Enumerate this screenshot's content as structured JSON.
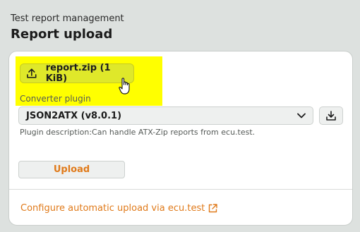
{
  "header": {
    "section": "Test report management",
    "title": "Report upload"
  },
  "file_select": {
    "label": "report.zip (1 KiB)",
    "icon": "upload-icon",
    "highlight_color": "#ffff00"
  },
  "converter": {
    "label": "Converter plugin",
    "selected": "JSON2ATX (v8.0.1)",
    "description": "Plugin description:Can handle ATX-Zip reports from ecu.test.",
    "download_icon": "download-icon"
  },
  "actions": {
    "upload_label": "Upload"
  },
  "footer": {
    "config_link": "Configure automatic upload via ecu.test",
    "link_icon": "external-link-icon"
  },
  "colors": {
    "accent": "#e07a1a",
    "file_button": "#dfe82a",
    "background": "#dde1df"
  }
}
